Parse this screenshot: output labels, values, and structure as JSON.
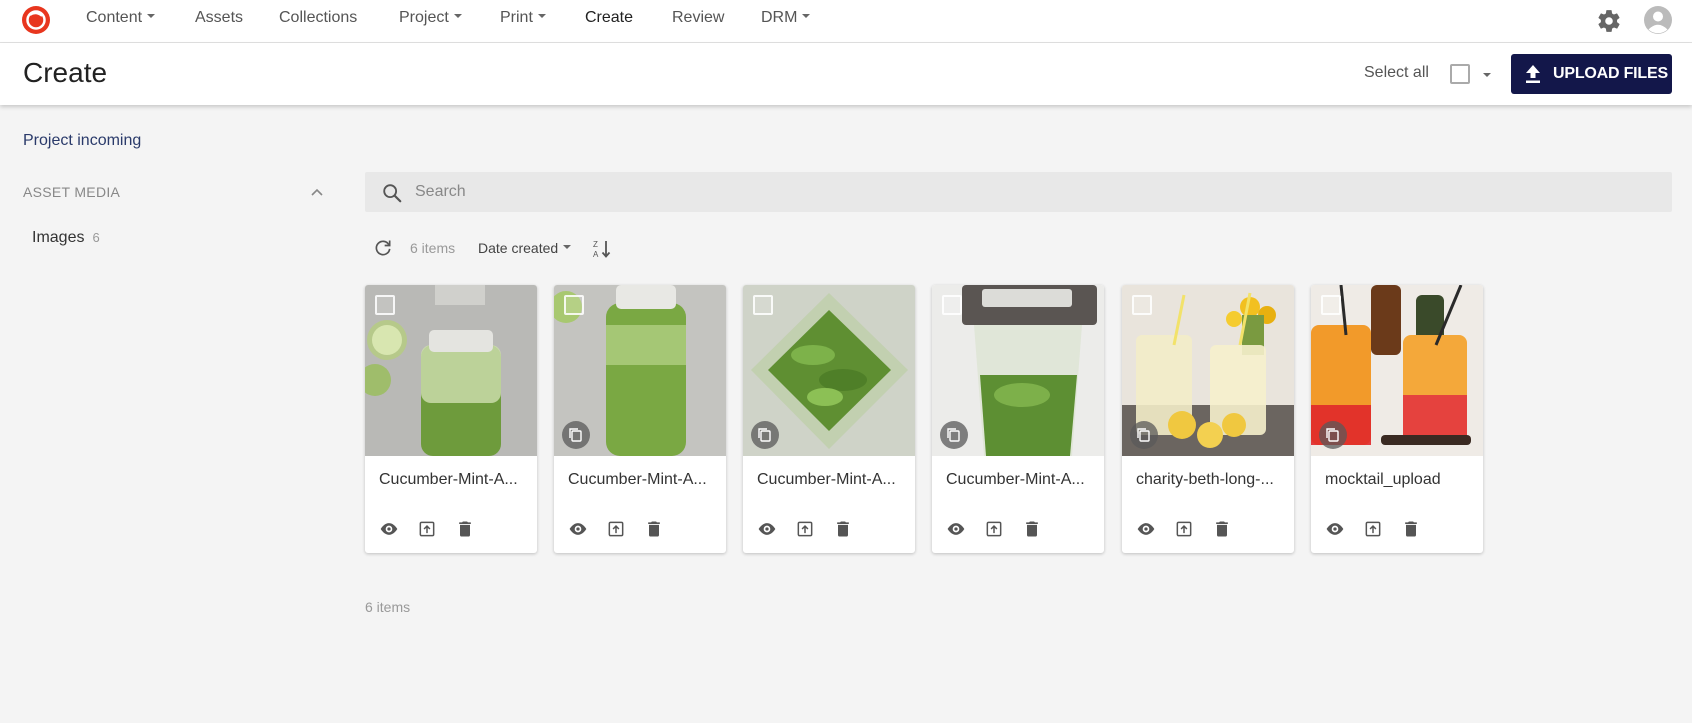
{
  "nav": {
    "items": [
      {
        "label": "Content",
        "dropdown": true
      },
      {
        "label": "Assets",
        "dropdown": false
      },
      {
        "label": "Collections",
        "dropdown": false
      },
      {
        "label": "Project",
        "dropdown": true
      },
      {
        "label": "Print",
        "dropdown": true
      },
      {
        "label": "Create",
        "dropdown": false,
        "active": true
      },
      {
        "label": "Review",
        "dropdown": false
      },
      {
        "label": "DRM",
        "dropdown": true
      }
    ]
  },
  "header": {
    "title": "Create",
    "select_all_label": "Select all",
    "upload_label": "UPLOAD FILES"
  },
  "sidebar": {
    "project_link": "Project incoming",
    "section_label": "ASSET MEDIA",
    "images_label": "Images",
    "images_count": "6"
  },
  "search": {
    "placeholder": "Search"
  },
  "toolbar": {
    "items_count": "6 items",
    "sort_label": "Date created"
  },
  "cards": [
    {
      "name": "Cucumber-Mint-A...",
      "has_versions": false
    },
    {
      "name": "Cucumber-Mint-A...",
      "has_versions": true
    },
    {
      "name": "Cucumber-Mint-A...",
      "has_versions": true
    },
    {
      "name": "Cucumber-Mint-A...",
      "has_versions": true
    },
    {
      "name": "charity-beth-long-...",
      "has_versions": true
    },
    {
      "name": "mocktail_upload",
      "has_versions": true
    }
  ],
  "footer": {
    "items_count": "6 items"
  },
  "colors": {
    "brand": "#e8361e",
    "primary_button": "#13174a",
    "page_bg": "#f4f4f4"
  }
}
